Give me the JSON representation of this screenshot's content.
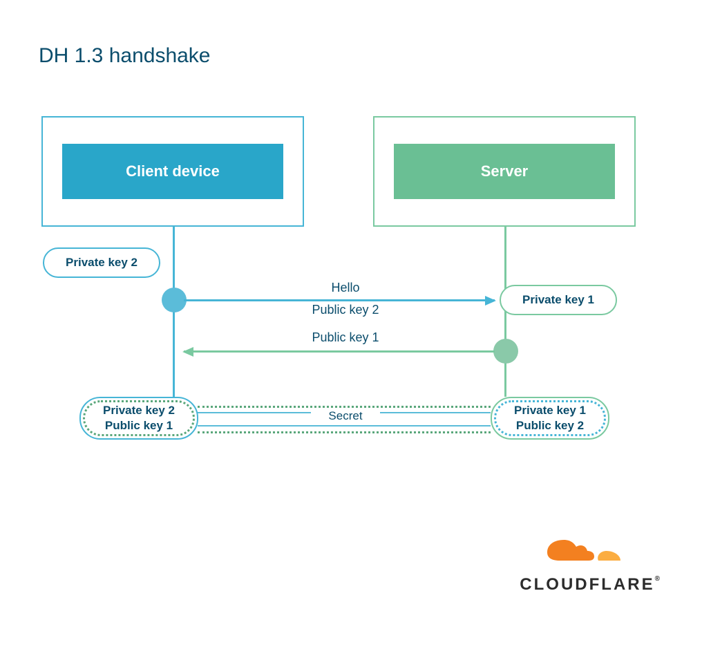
{
  "title": "DH 1.3 handshake",
  "client": {
    "label": "Client device",
    "private_key_label": "Private key 2",
    "combined": {
      "line1": "Private key 2",
      "line2": "Public key 1"
    }
  },
  "server": {
    "label": "Server",
    "private_key_label": "Private key 1",
    "combined": {
      "line1": "Private key 1",
      "line2": "Public key 2"
    }
  },
  "messages": {
    "hello": "Hello",
    "client_public": "Public key 2",
    "server_public": "Public key 1"
  },
  "secret_label": "Secret",
  "logo": "CLOUDFLARE"
}
